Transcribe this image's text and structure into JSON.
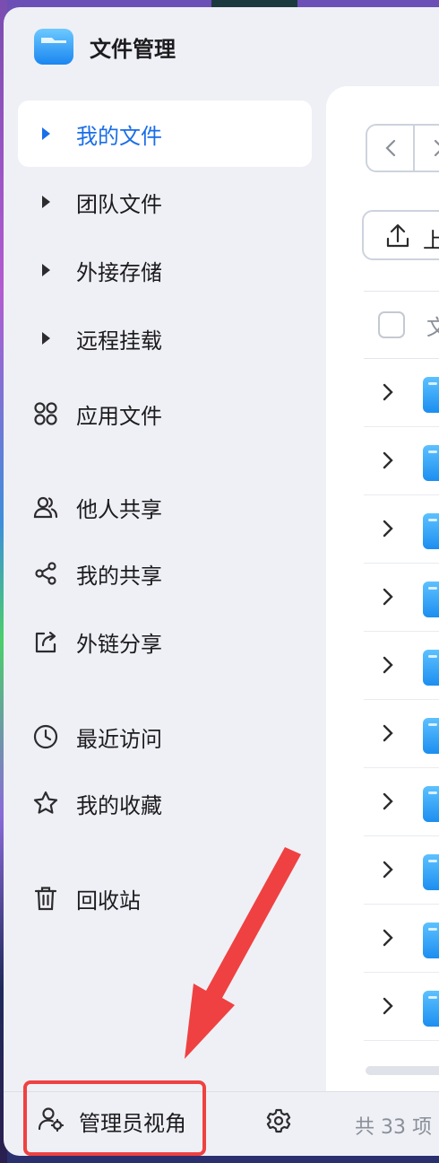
{
  "app": {
    "title": "文件管理"
  },
  "sidebar": {
    "items": [
      {
        "label": "我的文件",
        "icon": "caret-right-icon",
        "active": true
      },
      {
        "label": "团队文件",
        "icon": "caret-right-icon"
      },
      {
        "label": "外接存储",
        "icon": "caret-right-icon"
      },
      {
        "label": "远程挂载",
        "icon": "caret-right-icon"
      },
      {
        "label": "应用文件",
        "icon": "apps-grid-icon"
      },
      {
        "label": "他人共享",
        "icon": "users-icon"
      },
      {
        "label": "我的共享",
        "icon": "share-icon"
      },
      {
        "label": "外链分享",
        "icon": "external-share-icon"
      },
      {
        "label": "最近访问",
        "icon": "clock-icon"
      },
      {
        "label": "我的收藏",
        "icon": "star-icon"
      },
      {
        "label": "回收站",
        "icon": "trash-icon"
      }
    ]
  },
  "toolbar": {
    "upload_label": "上"
  },
  "table": {
    "name_column": "文"
  },
  "footer": {
    "admin_view_label": "管理员视角",
    "count_text": "共 33 项"
  },
  "colors": {
    "accent": "#1a6ee8",
    "highlight": "#ef4141"
  }
}
